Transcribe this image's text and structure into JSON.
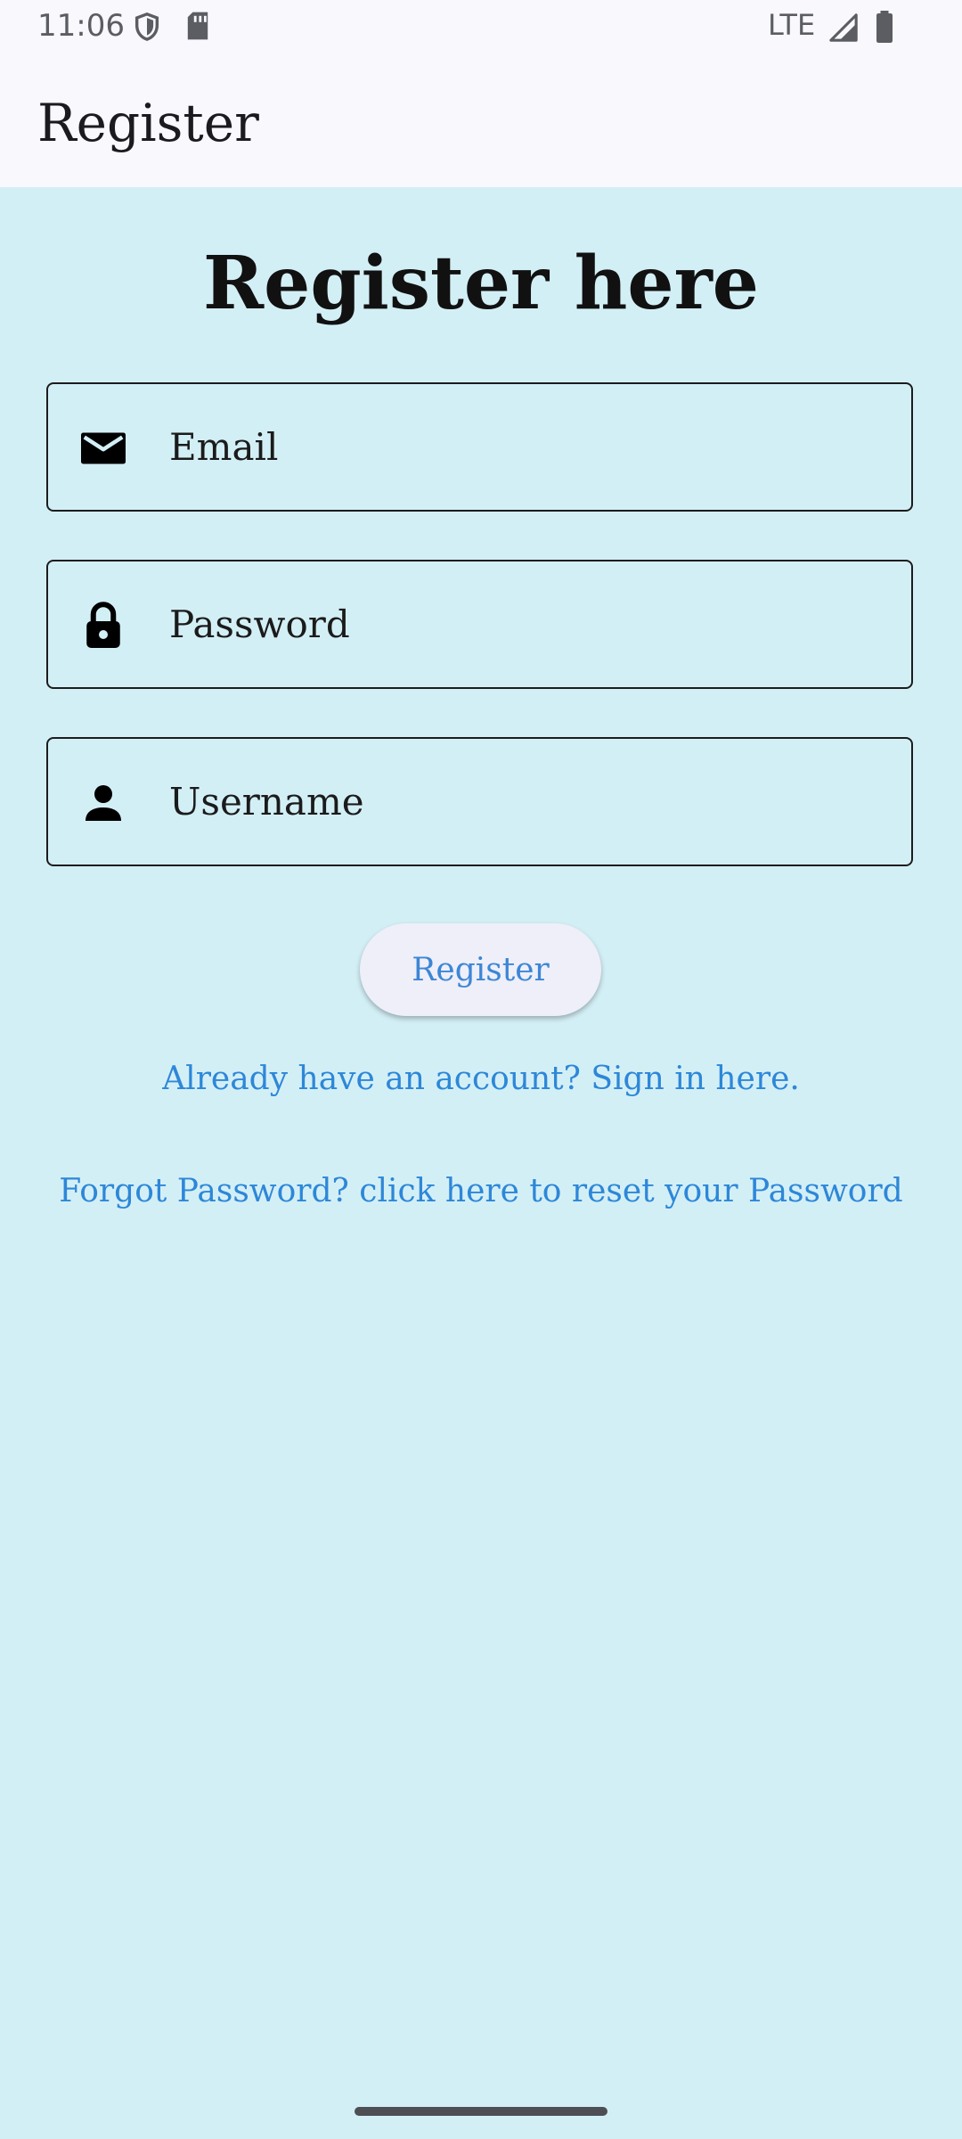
{
  "status_bar": {
    "time": "11:06",
    "network": "LTE",
    "icons": [
      "shield-icon",
      "sd-card-icon",
      "signal-icon",
      "battery-icon"
    ]
  },
  "app_bar": {
    "title": "Register"
  },
  "form": {
    "heading": "Register here",
    "email": {
      "placeholder": "Email",
      "value": "",
      "icon": "envelope-icon"
    },
    "password": {
      "placeholder": "Password",
      "value": "",
      "icon": "lock-icon"
    },
    "username": {
      "placeholder": "Username",
      "value": "",
      "icon": "person-icon"
    },
    "register_label": "Register",
    "signin_link": "Already have an account? Sign in here.",
    "forgot_link": "Forgot Password? click here to reset your Password"
  },
  "colors": {
    "background": "#d3eff6",
    "app_bar": "#f8f8fd",
    "link": "#2d87d8",
    "button_bg": "#eeeff8"
  }
}
